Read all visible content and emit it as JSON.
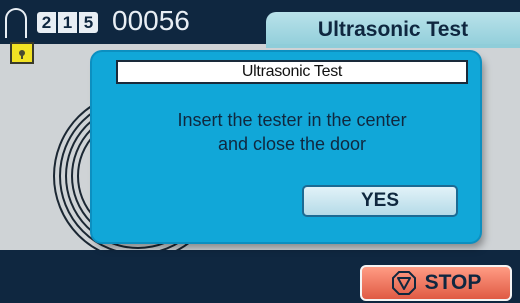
{
  "header": {
    "code_digits": [
      "2",
      "1",
      "5"
    ],
    "counter": "00056",
    "tab_title": "Ultrasonic Test",
    "lock_icon": "padlock-icon"
  },
  "dialog": {
    "title": "Ultrasonic Test",
    "message_line1": "Insert the tester in the center",
    "message_line2": "and close the door",
    "yes_label": "YES"
  },
  "footer": {
    "stop_label": "STOP",
    "stop_icon": "stop-octagon-icon"
  },
  "colors": {
    "background": "#0f2740",
    "panel": "#cfd3d6",
    "tab": "#a9dbe6",
    "dialog": "#11a7d8",
    "stop": "#f07a62",
    "lock": "#f2e224"
  }
}
